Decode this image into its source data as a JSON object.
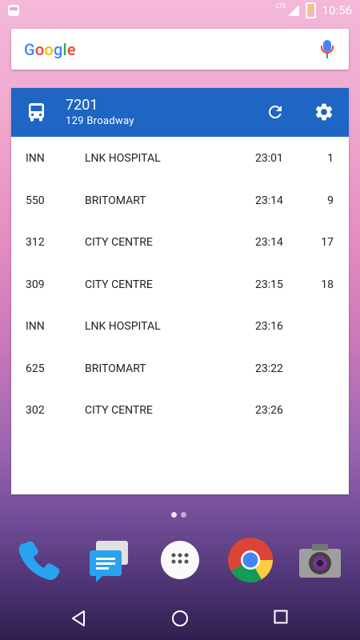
{
  "status_bar": {
    "network": "LTE",
    "time": "10:56"
  },
  "search": {
    "logo": [
      "G",
      "o",
      "o",
      "g",
      "l",
      "e"
    ]
  },
  "widget": {
    "stop_number": "7201",
    "stop_name": "129 Broadway",
    "icons": {
      "bus": "bus-icon",
      "refresh": "refresh-icon",
      "settings": "gear-icon"
    },
    "rows": [
      {
        "route": "INN",
        "destination": "LNK HOSPITAL",
        "time": "23:01",
        "mins": "1"
      },
      {
        "route": "550",
        "destination": "BRITOMART",
        "time": "23:14",
        "mins": "9"
      },
      {
        "route": "312",
        "destination": "CITY CENTRE",
        "time": "23:14",
        "mins": "17"
      },
      {
        "route": "309",
        "destination": "CITY CENTRE",
        "time": "23:15",
        "mins": "18"
      },
      {
        "route": "INN",
        "destination": "LNK HOSPITAL",
        "time": "23:16",
        "mins": ""
      },
      {
        "route": "625",
        "destination": "BRITOMART",
        "time": "23:22",
        "mins": ""
      },
      {
        "route": "302",
        "destination": "CITY CENTRE",
        "time": "23:26",
        "mins": ""
      }
    ]
  },
  "dock": [
    "phone-icon",
    "messenger-icon",
    "app-drawer-icon",
    "chrome-icon",
    "camera-icon"
  ],
  "nav": [
    "back-icon",
    "home-icon",
    "recents-icon"
  ],
  "colors": {
    "header_blue": "#1f65c4"
  }
}
